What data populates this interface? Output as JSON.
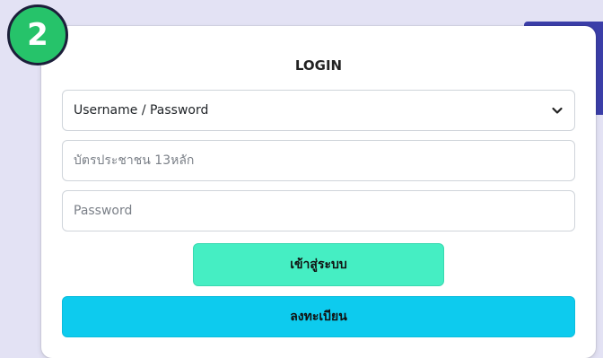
{
  "badge": {
    "number": "2"
  },
  "form": {
    "title": "LOGIN",
    "login_method": {
      "selected": "Username / Password"
    },
    "id_field": {
      "placeholder": "บัตรประชาชน 13หลัก"
    },
    "password_field": {
      "placeholder": "Password"
    },
    "login_button": "เข้าสู่ระบบ",
    "register_button": "ลงทะเบียน"
  },
  "colors": {
    "background": "#e3e2f4",
    "badge_green": "#26c36a",
    "login_button": "#45eec3",
    "register_button": "#0dcbee",
    "header_strip": "#3b3ea8"
  },
  "icons": {
    "select_arrow": "chevron-down-icon"
  }
}
